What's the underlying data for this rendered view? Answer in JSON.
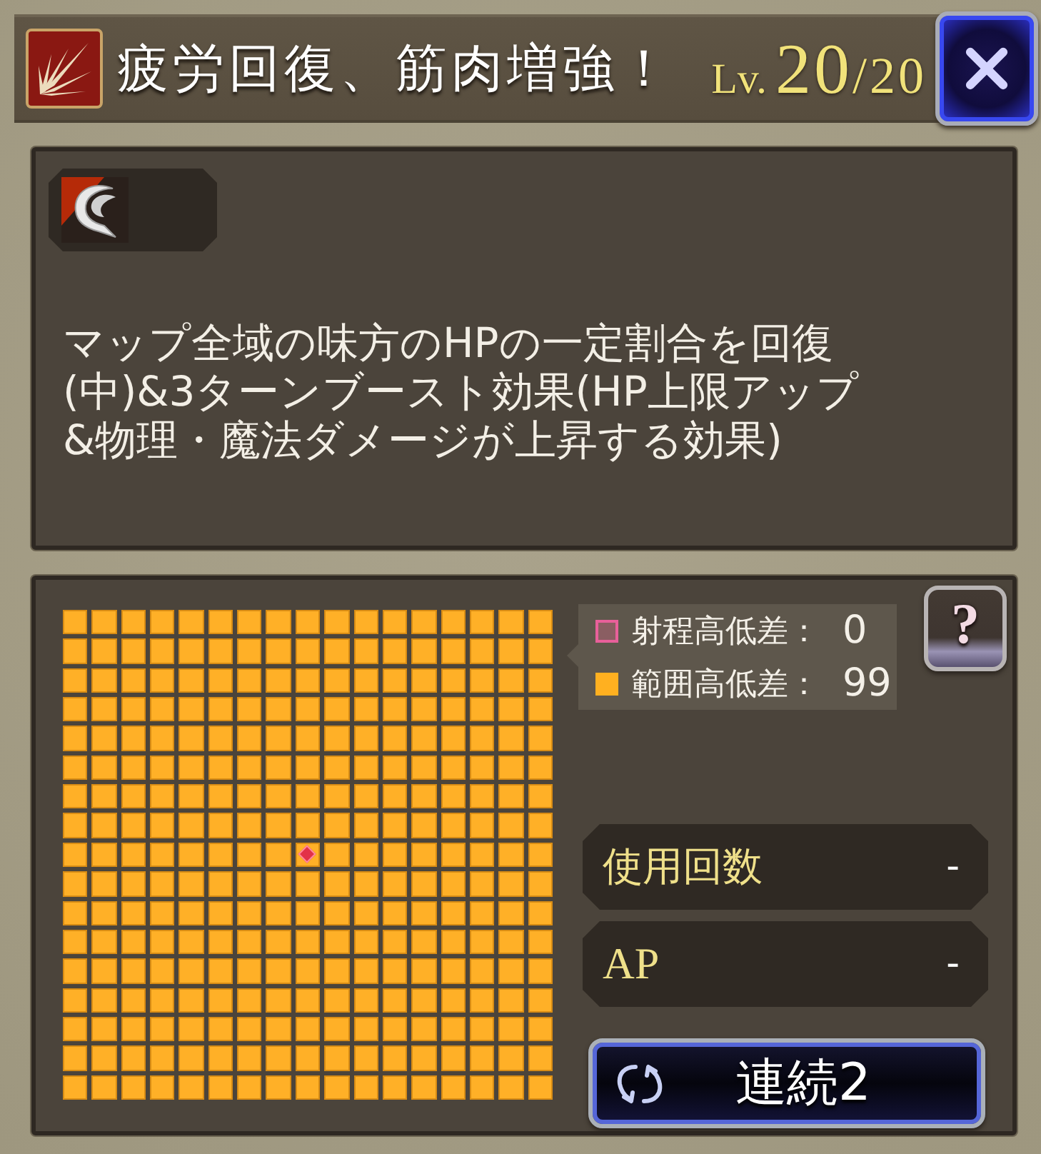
{
  "header": {
    "title": "疲労回復、筋肉増強！",
    "level_prefix": "Lv.",
    "level": "20",
    "level_max": "/20"
  },
  "skill": {
    "description": "マップ全域の味方のHPの一定割合を回復(中)&3ターンブースト効果(HP上限アップ&物理・魔法ダメージが上昇する効果)"
  },
  "range_map": {
    "rows": [
      {
        "cells": [
          {
            "in_range": true,
            "origin": false
          },
          {
            "in_range": true,
            "origin": false
          },
          {
            "in_range": true,
            "origin": false
          },
          {
            "in_range": true,
            "origin": false
          },
          {
            "in_range": true,
            "origin": false
          },
          {
            "in_range": true,
            "origin": false
          },
          {
            "in_range": true,
            "origin": false
          },
          {
            "in_range": true,
            "origin": false
          },
          {
            "in_range": true,
            "origin": false
          },
          {
            "in_range": true,
            "origin": false
          },
          {
            "in_range": true,
            "origin": false
          },
          {
            "in_range": true,
            "origin": false
          },
          {
            "in_range": true,
            "origin": false
          },
          {
            "in_range": true,
            "origin": false
          },
          {
            "in_range": true,
            "origin": false
          },
          {
            "in_range": true,
            "origin": false
          },
          {
            "in_range": true,
            "origin": false
          }
        ]
      },
      {
        "cells": [
          {
            "in_range": true,
            "origin": false
          },
          {
            "in_range": true,
            "origin": false
          },
          {
            "in_range": true,
            "origin": false
          },
          {
            "in_range": true,
            "origin": false
          },
          {
            "in_range": true,
            "origin": false
          },
          {
            "in_range": true,
            "origin": false
          },
          {
            "in_range": true,
            "origin": false
          },
          {
            "in_range": true,
            "origin": false
          },
          {
            "in_range": true,
            "origin": false
          },
          {
            "in_range": true,
            "origin": false
          },
          {
            "in_range": true,
            "origin": false
          },
          {
            "in_range": true,
            "origin": false
          },
          {
            "in_range": true,
            "origin": false
          },
          {
            "in_range": true,
            "origin": false
          },
          {
            "in_range": true,
            "origin": false
          },
          {
            "in_range": true,
            "origin": false
          },
          {
            "in_range": true,
            "origin": false
          }
        ]
      },
      {
        "cells": [
          {
            "in_range": true,
            "origin": false
          },
          {
            "in_range": true,
            "origin": false
          },
          {
            "in_range": true,
            "origin": false
          },
          {
            "in_range": true,
            "origin": false
          },
          {
            "in_range": true,
            "origin": false
          },
          {
            "in_range": true,
            "origin": false
          },
          {
            "in_range": true,
            "origin": false
          },
          {
            "in_range": true,
            "origin": false
          },
          {
            "in_range": true,
            "origin": false
          },
          {
            "in_range": true,
            "origin": false
          },
          {
            "in_range": true,
            "origin": false
          },
          {
            "in_range": true,
            "origin": false
          },
          {
            "in_range": true,
            "origin": false
          },
          {
            "in_range": true,
            "origin": false
          },
          {
            "in_range": true,
            "origin": false
          },
          {
            "in_range": true,
            "origin": false
          },
          {
            "in_range": true,
            "origin": false
          }
        ]
      },
      {
        "cells": [
          {
            "in_range": true,
            "origin": false
          },
          {
            "in_range": true,
            "origin": false
          },
          {
            "in_range": true,
            "origin": false
          },
          {
            "in_range": true,
            "origin": false
          },
          {
            "in_range": true,
            "origin": false
          },
          {
            "in_range": true,
            "origin": false
          },
          {
            "in_range": true,
            "origin": false
          },
          {
            "in_range": true,
            "origin": false
          },
          {
            "in_range": true,
            "origin": false
          },
          {
            "in_range": true,
            "origin": false
          },
          {
            "in_range": true,
            "origin": false
          },
          {
            "in_range": true,
            "origin": false
          },
          {
            "in_range": true,
            "origin": false
          },
          {
            "in_range": true,
            "origin": false
          },
          {
            "in_range": true,
            "origin": false
          },
          {
            "in_range": true,
            "origin": false
          },
          {
            "in_range": true,
            "origin": false
          }
        ]
      },
      {
        "cells": [
          {
            "in_range": true,
            "origin": false
          },
          {
            "in_range": true,
            "origin": false
          },
          {
            "in_range": true,
            "origin": false
          },
          {
            "in_range": true,
            "origin": false
          },
          {
            "in_range": true,
            "origin": false
          },
          {
            "in_range": true,
            "origin": false
          },
          {
            "in_range": true,
            "origin": false
          },
          {
            "in_range": true,
            "origin": false
          },
          {
            "in_range": true,
            "origin": false
          },
          {
            "in_range": true,
            "origin": false
          },
          {
            "in_range": true,
            "origin": false
          },
          {
            "in_range": true,
            "origin": false
          },
          {
            "in_range": true,
            "origin": false
          },
          {
            "in_range": true,
            "origin": false
          },
          {
            "in_range": true,
            "origin": false
          },
          {
            "in_range": true,
            "origin": false
          },
          {
            "in_range": true,
            "origin": false
          }
        ]
      },
      {
        "cells": [
          {
            "in_range": true,
            "origin": false
          },
          {
            "in_range": true,
            "origin": false
          },
          {
            "in_range": true,
            "origin": false
          },
          {
            "in_range": true,
            "origin": false
          },
          {
            "in_range": true,
            "origin": false
          },
          {
            "in_range": true,
            "origin": false
          },
          {
            "in_range": true,
            "origin": false
          },
          {
            "in_range": true,
            "origin": false
          },
          {
            "in_range": true,
            "origin": false
          },
          {
            "in_range": true,
            "origin": false
          },
          {
            "in_range": true,
            "origin": false
          },
          {
            "in_range": true,
            "origin": false
          },
          {
            "in_range": true,
            "origin": false
          },
          {
            "in_range": true,
            "origin": false
          },
          {
            "in_range": true,
            "origin": false
          },
          {
            "in_range": true,
            "origin": false
          },
          {
            "in_range": true,
            "origin": false
          }
        ]
      },
      {
        "cells": [
          {
            "in_range": true,
            "origin": false
          },
          {
            "in_range": true,
            "origin": false
          },
          {
            "in_range": true,
            "origin": false
          },
          {
            "in_range": true,
            "origin": false
          },
          {
            "in_range": true,
            "origin": false
          },
          {
            "in_range": true,
            "origin": false
          },
          {
            "in_range": true,
            "origin": false
          },
          {
            "in_range": true,
            "origin": false
          },
          {
            "in_range": true,
            "origin": false
          },
          {
            "in_range": true,
            "origin": false
          },
          {
            "in_range": true,
            "origin": false
          },
          {
            "in_range": true,
            "origin": false
          },
          {
            "in_range": true,
            "origin": false
          },
          {
            "in_range": true,
            "origin": false
          },
          {
            "in_range": true,
            "origin": false
          },
          {
            "in_range": true,
            "origin": false
          },
          {
            "in_range": true,
            "origin": false
          }
        ]
      },
      {
        "cells": [
          {
            "in_range": true,
            "origin": false
          },
          {
            "in_range": true,
            "origin": false
          },
          {
            "in_range": true,
            "origin": false
          },
          {
            "in_range": true,
            "origin": false
          },
          {
            "in_range": true,
            "origin": false
          },
          {
            "in_range": true,
            "origin": false
          },
          {
            "in_range": true,
            "origin": false
          },
          {
            "in_range": true,
            "origin": false
          },
          {
            "in_range": true,
            "origin": false
          },
          {
            "in_range": true,
            "origin": false
          },
          {
            "in_range": true,
            "origin": false
          },
          {
            "in_range": true,
            "origin": false
          },
          {
            "in_range": true,
            "origin": false
          },
          {
            "in_range": true,
            "origin": false
          },
          {
            "in_range": true,
            "origin": false
          },
          {
            "in_range": true,
            "origin": false
          },
          {
            "in_range": true,
            "origin": false
          }
        ]
      },
      {
        "cells": [
          {
            "in_range": true,
            "origin": false
          },
          {
            "in_range": true,
            "origin": false
          },
          {
            "in_range": true,
            "origin": false
          },
          {
            "in_range": true,
            "origin": false
          },
          {
            "in_range": true,
            "origin": false
          },
          {
            "in_range": true,
            "origin": false
          },
          {
            "in_range": true,
            "origin": false
          },
          {
            "in_range": true,
            "origin": false
          },
          {
            "in_range": true,
            "origin": true
          },
          {
            "in_range": true,
            "origin": false
          },
          {
            "in_range": true,
            "origin": false
          },
          {
            "in_range": true,
            "origin": false
          },
          {
            "in_range": true,
            "origin": false
          },
          {
            "in_range": true,
            "origin": false
          },
          {
            "in_range": true,
            "origin": false
          },
          {
            "in_range": true,
            "origin": false
          },
          {
            "in_range": true,
            "origin": false
          }
        ]
      },
      {
        "cells": [
          {
            "in_range": true,
            "origin": false
          },
          {
            "in_range": true,
            "origin": false
          },
          {
            "in_range": true,
            "origin": false
          },
          {
            "in_range": true,
            "origin": false
          },
          {
            "in_range": true,
            "origin": false
          },
          {
            "in_range": true,
            "origin": false
          },
          {
            "in_range": true,
            "origin": false
          },
          {
            "in_range": true,
            "origin": false
          },
          {
            "in_range": true,
            "origin": false
          },
          {
            "in_range": true,
            "origin": false
          },
          {
            "in_range": true,
            "origin": false
          },
          {
            "in_range": true,
            "origin": false
          },
          {
            "in_range": true,
            "origin": false
          },
          {
            "in_range": true,
            "origin": false
          },
          {
            "in_range": true,
            "origin": false
          },
          {
            "in_range": true,
            "origin": false
          },
          {
            "in_range": true,
            "origin": false
          }
        ]
      },
      {
        "cells": [
          {
            "in_range": true,
            "origin": false
          },
          {
            "in_range": true,
            "origin": false
          },
          {
            "in_range": true,
            "origin": false
          },
          {
            "in_range": true,
            "origin": false
          },
          {
            "in_range": true,
            "origin": false
          },
          {
            "in_range": true,
            "origin": false
          },
          {
            "in_range": true,
            "origin": false
          },
          {
            "in_range": true,
            "origin": false
          },
          {
            "in_range": true,
            "origin": false
          },
          {
            "in_range": true,
            "origin": false
          },
          {
            "in_range": true,
            "origin": false
          },
          {
            "in_range": true,
            "origin": false
          },
          {
            "in_range": true,
            "origin": false
          },
          {
            "in_range": true,
            "origin": false
          },
          {
            "in_range": true,
            "origin": false
          },
          {
            "in_range": true,
            "origin": false
          },
          {
            "in_range": true,
            "origin": false
          }
        ]
      },
      {
        "cells": [
          {
            "in_range": true,
            "origin": false
          },
          {
            "in_range": true,
            "origin": false
          },
          {
            "in_range": true,
            "origin": false
          },
          {
            "in_range": true,
            "origin": false
          },
          {
            "in_range": true,
            "origin": false
          },
          {
            "in_range": true,
            "origin": false
          },
          {
            "in_range": true,
            "origin": false
          },
          {
            "in_range": true,
            "origin": false
          },
          {
            "in_range": true,
            "origin": false
          },
          {
            "in_range": true,
            "origin": false
          },
          {
            "in_range": true,
            "origin": false
          },
          {
            "in_range": true,
            "origin": false
          },
          {
            "in_range": true,
            "origin": false
          },
          {
            "in_range": true,
            "origin": false
          },
          {
            "in_range": true,
            "origin": false
          },
          {
            "in_range": true,
            "origin": false
          },
          {
            "in_range": true,
            "origin": false
          }
        ]
      },
      {
        "cells": [
          {
            "in_range": true,
            "origin": false
          },
          {
            "in_range": true,
            "origin": false
          },
          {
            "in_range": true,
            "origin": false
          },
          {
            "in_range": true,
            "origin": false
          },
          {
            "in_range": true,
            "origin": false
          },
          {
            "in_range": true,
            "origin": false
          },
          {
            "in_range": true,
            "origin": false
          },
          {
            "in_range": true,
            "origin": false
          },
          {
            "in_range": true,
            "origin": false
          },
          {
            "in_range": true,
            "origin": false
          },
          {
            "in_range": true,
            "origin": false
          },
          {
            "in_range": true,
            "origin": false
          },
          {
            "in_range": true,
            "origin": false
          },
          {
            "in_range": true,
            "origin": false
          },
          {
            "in_range": true,
            "origin": false
          },
          {
            "in_range": true,
            "origin": false
          },
          {
            "in_range": true,
            "origin": false
          }
        ]
      },
      {
        "cells": [
          {
            "in_range": true,
            "origin": false
          },
          {
            "in_range": true,
            "origin": false
          },
          {
            "in_range": true,
            "origin": false
          },
          {
            "in_range": true,
            "origin": false
          },
          {
            "in_range": true,
            "origin": false
          },
          {
            "in_range": true,
            "origin": false
          },
          {
            "in_range": true,
            "origin": false
          },
          {
            "in_range": true,
            "origin": false
          },
          {
            "in_range": true,
            "origin": false
          },
          {
            "in_range": true,
            "origin": false
          },
          {
            "in_range": true,
            "origin": false
          },
          {
            "in_range": true,
            "origin": false
          },
          {
            "in_range": true,
            "origin": false
          },
          {
            "in_range": true,
            "origin": false
          },
          {
            "in_range": true,
            "origin": false
          },
          {
            "in_range": true,
            "origin": false
          },
          {
            "in_range": true,
            "origin": false
          }
        ]
      },
      {
        "cells": [
          {
            "in_range": true,
            "origin": false
          },
          {
            "in_range": true,
            "origin": false
          },
          {
            "in_range": true,
            "origin": false
          },
          {
            "in_range": true,
            "origin": false
          },
          {
            "in_range": true,
            "origin": false
          },
          {
            "in_range": true,
            "origin": false
          },
          {
            "in_range": true,
            "origin": false
          },
          {
            "in_range": true,
            "origin": false
          },
          {
            "in_range": true,
            "origin": false
          },
          {
            "in_range": true,
            "origin": false
          },
          {
            "in_range": true,
            "origin": false
          },
          {
            "in_range": true,
            "origin": false
          },
          {
            "in_range": true,
            "origin": false
          },
          {
            "in_range": true,
            "origin": false
          },
          {
            "in_range": true,
            "origin": false
          },
          {
            "in_range": true,
            "origin": false
          },
          {
            "in_range": true,
            "origin": false
          }
        ]
      },
      {
        "cells": [
          {
            "in_range": true,
            "origin": false
          },
          {
            "in_range": true,
            "origin": false
          },
          {
            "in_range": true,
            "origin": false
          },
          {
            "in_range": true,
            "origin": false
          },
          {
            "in_range": true,
            "origin": false
          },
          {
            "in_range": true,
            "origin": false
          },
          {
            "in_range": true,
            "origin": false
          },
          {
            "in_range": true,
            "origin": false
          },
          {
            "in_range": true,
            "origin": false
          },
          {
            "in_range": true,
            "origin": false
          },
          {
            "in_range": true,
            "origin": false
          },
          {
            "in_range": true,
            "origin": false
          },
          {
            "in_range": true,
            "origin": false
          },
          {
            "in_range": true,
            "origin": false
          },
          {
            "in_range": true,
            "origin": false
          },
          {
            "in_range": true,
            "origin": false
          },
          {
            "in_range": true,
            "origin": false
          }
        ]
      },
      {
        "cells": [
          {
            "in_range": true,
            "origin": false
          },
          {
            "in_range": true,
            "origin": false
          },
          {
            "in_range": true,
            "origin": false
          },
          {
            "in_range": true,
            "origin": false
          },
          {
            "in_range": true,
            "origin": false
          },
          {
            "in_range": true,
            "origin": false
          },
          {
            "in_range": true,
            "origin": false
          },
          {
            "in_range": true,
            "origin": false
          },
          {
            "in_range": true,
            "origin": false
          },
          {
            "in_range": true,
            "origin": false
          },
          {
            "in_range": true,
            "origin": false
          },
          {
            "in_range": true,
            "origin": false
          },
          {
            "in_range": true,
            "origin": false
          },
          {
            "in_range": true,
            "origin": false
          },
          {
            "in_range": true,
            "origin": false
          },
          {
            "in_range": true,
            "origin": false
          },
          {
            "in_range": true,
            "origin": false
          }
        ]
      }
    ]
  },
  "legend": [
    {
      "kind": "outline",
      "label": "射程高低差：",
      "value": "0",
      "color": "#e8609a"
    },
    {
      "kind": "filled",
      "label": "範囲高低差：",
      "value": "99",
      "color": "#ffb020"
    }
  ],
  "help_button": {
    "label": "?"
  },
  "stats": [
    {
      "kind": "text",
      "label": "使用回数",
      "value": "-"
    },
    {
      "kind": "serif",
      "label": "AP",
      "value": "-"
    }
  ],
  "chain_button": {
    "label": "連続2"
  }
}
